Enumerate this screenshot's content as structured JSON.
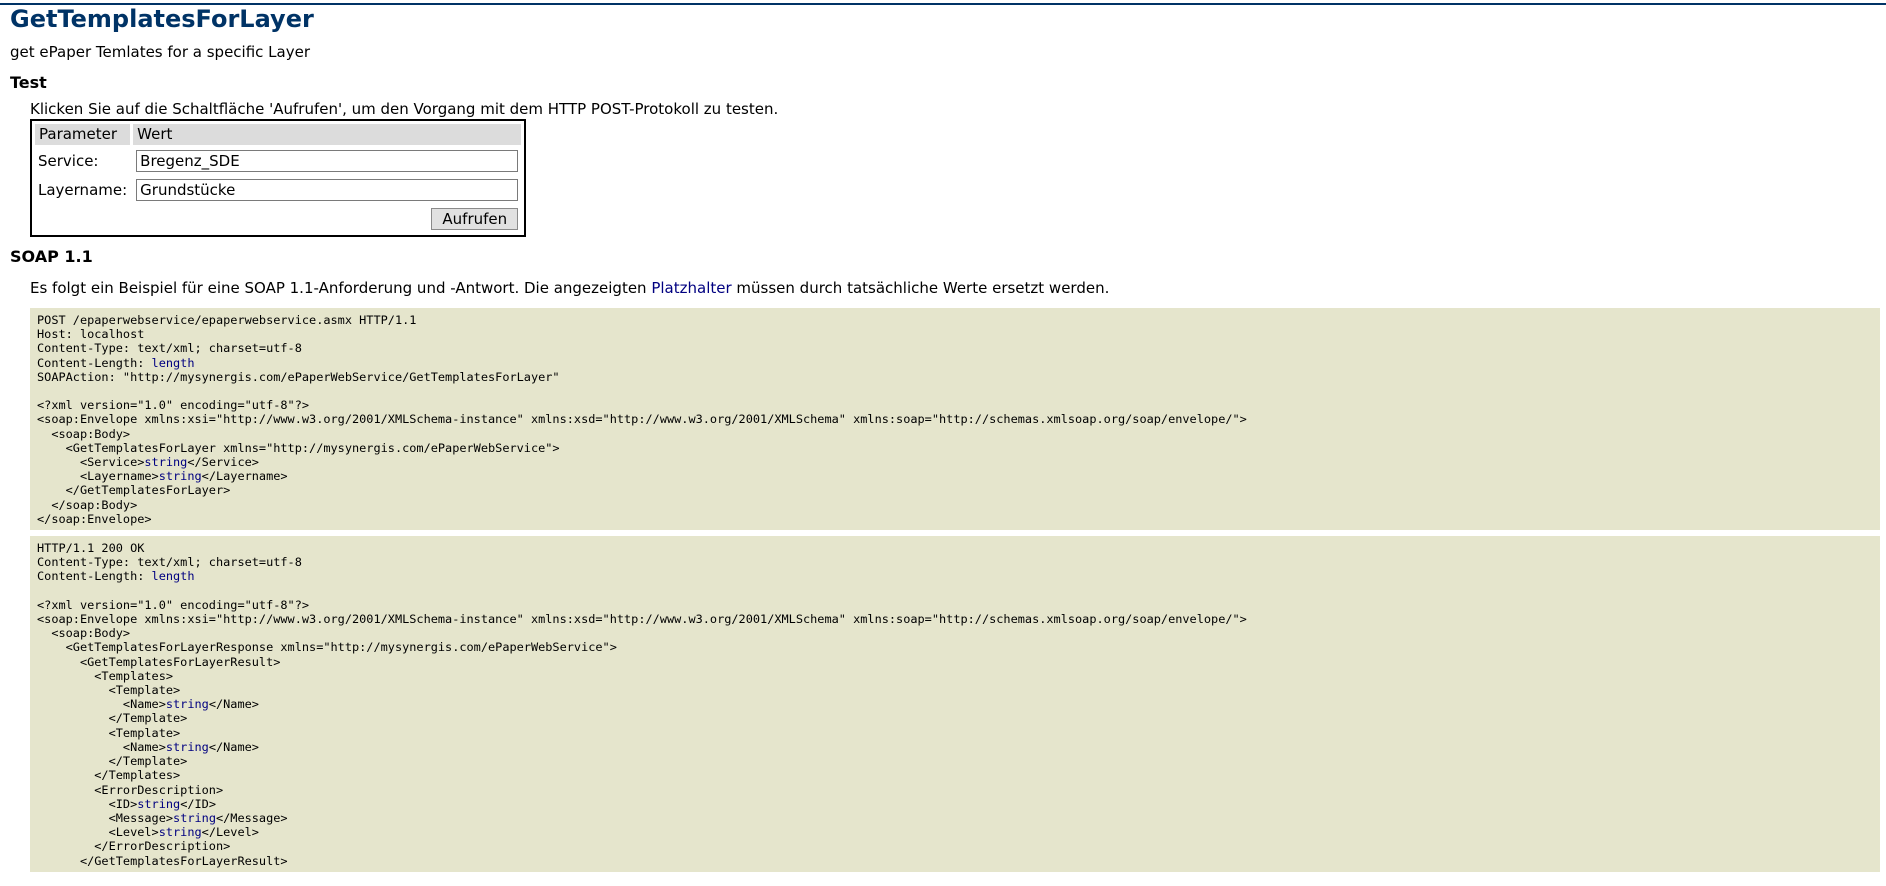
{
  "page": {
    "title": "GetTemplatesForLayer",
    "description": "get ePaper Temlates for a specific Layer"
  },
  "test": {
    "heading": "Test",
    "intro": "Klicken Sie auf die Schaltfläche 'Aufrufen', um den Vorgang mit dem HTTP POST-Protokoll zu testen.",
    "columns": [
      "Parameter",
      "Wert"
    ],
    "fields": [
      {
        "label": "Service:",
        "value": "Bregenz_SDE"
      },
      {
        "label": "Layername:",
        "value": "Grundstücke"
      }
    ],
    "submit_label": "Aufrufen"
  },
  "soap11": {
    "heading": "SOAP 1.1",
    "intro_before": "Es folgt ein Beispiel für eine SOAP 1.1-Anforderung und -Antwort. Die angezeigten ",
    "intro_link": "Platzhalter",
    "intro_after": " müssen durch tatsächliche Werte ersetzt werden.",
    "request_lines": [
      [
        {
          "t": "POST /epaperwebservice/epaperwebservice.asmx HTTP/1.1"
        }
      ],
      [
        {
          "t": "Host: localhost"
        }
      ],
      [
        {
          "t": "Content-Type: text/xml; charset=utf-8"
        }
      ],
      [
        {
          "t": "Content-Length: "
        },
        {
          "t": "length",
          "v": true
        }
      ],
      [
        {
          "t": "SOAPAction: \"http://mysynergis.com/ePaperWebService/GetTemplatesForLayer\""
        }
      ],
      [
        {
          "t": ""
        }
      ],
      [
        {
          "t": "<?xml version=\"1.0\" encoding=\"utf-8\"?>"
        }
      ],
      [
        {
          "t": "<soap:Envelope xmlns:xsi=\"http://www.w3.org/2001/XMLSchema-instance\" xmlns:xsd=\"http://www.w3.org/2001/XMLSchema\" xmlns:soap=\"http://schemas.xmlsoap.org/soap/envelope/\">"
        }
      ],
      [
        {
          "t": "  <soap:Body>"
        }
      ],
      [
        {
          "t": "    <GetTemplatesForLayer xmlns=\"http://mysynergis.com/ePaperWebService\">"
        }
      ],
      [
        {
          "t": "      <Service>"
        },
        {
          "t": "string",
          "v": true
        },
        {
          "t": "</Service>"
        }
      ],
      [
        {
          "t": "      <Layername>"
        },
        {
          "t": "string",
          "v": true
        },
        {
          "t": "</Layername>"
        }
      ],
      [
        {
          "t": "    </GetTemplatesForLayer>"
        }
      ],
      [
        {
          "t": "  </soap:Body>"
        }
      ],
      [
        {
          "t": "</soap:Envelope>"
        }
      ]
    ],
    "response_lines": [
      [
        {
          "t": "HTTP/1.1 200 OK"
        }
      ],
      [
        {
          "t": "Content-Type: text/xml; charset=utf-8"
        }
      ],
      [
        {
          "t": "Content-Length: "
        },
        {
          "t": "length",
          "v": true
        }
      ],
      [
        {
          "t": ""
        }
      ],
      [
        {
          "t": "<?xml version=\"1.0\" encoding=\"utf-8\"?>"
        }
      ],
      [
        {
          "t": "<soap:Envelope xmlns:xsi=\"http://www.w3.org/2001/XMLSchema-instance\" xmlns:xsd=\"http://www.w3.org/2001/XMLSchema\" xmlns:soap=\"http://schemas.xmlsoap.org/soap/envelope/\">"
        }
      ],
      [
        {
          "t": "  <soap:Body>"
        }
      ],
      [
        {
          "t": "    <GetTemplatesForLayerResponse xmlns=\"http://mysynergis.com/ePaperWebService\">"
        }
      ],
      [
        {
          "t": "      <GetTemplatesForLayerResult>"
        }
      ],
      [
        {
          "t": "        <Templates>"
        }
      ],
      [
        {
          "t": "          <Template>"
        }
      ],
      [
        {
          "t": "            <Name>"
        },
        {
          "t": "string",
          "v": true
        },
        {
          "t": "</Name>"
        }
      ],
      [
        {
          "t": "          </Template>"
        }
      ],
      [
        {
          "t": "          <Template>"
        }
      ],
      [
        {
          "t": "            <Name>"
        },
        {
          "t": "string",
          "v": true
        },
        {
          "t": "</Name>"
        }
      ],
      [
        {
          "t": "          </Template>"
        }
      ],
      [
        {
          "t": "        </Templates>"
        }
      ],
      [
        {
          "t": "        <ErrorDescription>"
        }
      ],
      [
        {
          "t": "          <ID>"
        },
        {
          "t": "string",
          "v": true
        },
        {
          "t": "</ID>"
        }
      ],
      [
        {
          "t": "          <Message>"
        },
        {
          "t": "string",
          "v": true
        },
        {
          "t": "</Message>"
        }
      ],
      [
        {
          "t": "          <Level>"
        },
        {
          "t": "string",
          "v": true
        },
        {
          "t": "</Level>"
        }
      ],
      [
        {
          "t": "        </ErrorDescription>"
        }
      ],
      [
        {
          "t": "      </GetTemplatesForLayerResult>"
        }
      ]
    ]
  },
  "colors": {
    "heading": "#003366",
    "placeholder": "#000080",
    "code_background": "#e5e5cc",
    "table_header": "#dcdcdc"
  }
}
